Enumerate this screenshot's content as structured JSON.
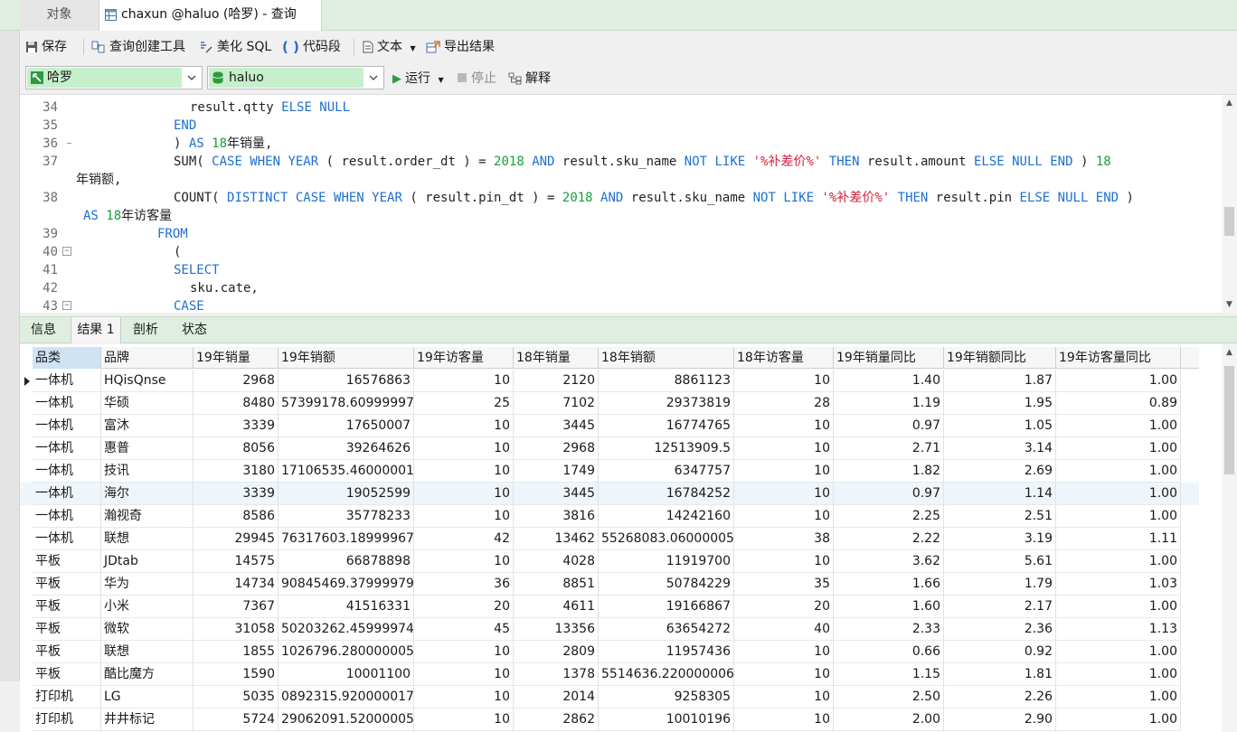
{
  "tabs": {
    "objects": "对象",
    "query": "chaxun @haluo (哈罗) - 查询"
  },
  "toolbar": {
    "save": "保存",
    "query_builder": "查询创建工具",
    "beautify": "美化 SQL",
    "snippet": "代码段",
    "text": "文本",
    "export": "导出结果"
  },
  "connection": {
    "connection_name": "哈罗",
    "database": "haluo",
    "run": "运行",
    "stop": "停止",
    "explain": "解释"
  },
  "editor": {
    "lines": [
      {
        "n": "34",
        "parts": [
          [
            "p",
            "    result.qtty "
          ],
          [
            "k",
            "ELSE NULL"
          ]
        ]
      },
      {
        "n": "35",
        "parts": [
          [
            "k",
            "  END"
          ]
        ]
      },
      {
        "n": "36",
        "parts": [
          [
            "p",
            "  ) "
          ],
          [
            "k",
            "AS "
          ],
          [
            "n",
            "18"
          ],
          [
            "p",
            "年销量,"
          ]
        ]
      },
      {
        "n": "37",
        "parts": [
          [
            "p",
            "  SUM( "
          ],
          [
            "k",
            "CASE WHEN YEAR "
          ],
          [
            "p",
            "( result.order_dt ) = "
          ],
          [
            "n",
            "2018 "
          ],
          [
            "k",
            "AND "
          ],
          [
            "p",
            "result.sku_name "
          ],
          [
            "k",
            "NOT LIKE "
          ],
          [
            "s",
            "'%补差价%' "
          ],
          [
            "k",
            "THEN "
          ],
          [
            "p",
            "result.amount "
          ],
          [
            "k",
            "ELSE NULL END "
          ],
          [
            "p",
            ") "
          ],
          [
            "n",
            "18"
          ]
        ]
      },
      {
        "n": "",
        "parts": [
          [
            "p",
            "年销额,"
          ]
        ]
      },
      {
        "n": "38",
        "parts": [
          [
            "p",
            "  COUNT( "
          ],
          [
            "k",
            "DISTINCT CASE WHEN YEAR "
          ],
          [
            "p",
            "( result.pin_dt ) = "
          ],
          [
            "n",
            "2018 "
          ],
          [
            "k",
            "AND "
          ],
          [
            "p",
            "result.sku_name "
          ],
          [
            "k",
            "NOT LIKE "
          ],
          [
            "s",
            "'%补差价%' "
          ],
          [
            "k",
            "THEN "
          ],
          [
            "p",
            "result.pin "
          ],
          [
            "k",
            "ELSE NULL END "
          ],
          [
            "p",
            ")"
          ]
        ]
      },
      {
        "n": "",
        "parts": [
          [
            "k",
            "AS "
          ],
          [
            "n",
            "18"
          ],
          [
            "p",
            "年访客量"
          ]
        ]
      },
      {
        "n": "39",
        "parts": [
          [
            "k",
            "FROM"
          ]
        ]
      },
      {
        "n": "40",
        "parts": [
          [
            "p",
            "  ("
          ]
        ]
      },
      {
        "n": "41",
        "parts": [
          [
            "k",
            "  SELECT"
          ]
        ]
      },
      {
        "n": "42",
        "parts": [
          [
            "p",
            "    sku.cate,"
          ]
        ]
      },
      {
        "n": "43",
        "parts": [
          [
            "k",
            "  CASE"
          ]
        ]
      }
    ]
  },
  "result_tabs": [
    "信息",
    "结果 1",
    "剖析",
    "状态"
  ],
  "grid": {
    "columns": [
      "品类",
      "品牌",
      "19年销量",
      "19年销额",
      "19年访客量",
      "18年销量",
      "18年销额",
      "18年访客量",
      "19年销量同比",
      "19年销额同比",
      "19年访客量同比"
    ],
    "rows": [
      [
        "一体机",
        "HQisQnse",
        "2968",
        "16576863",
        "10",
        "2120",
        "8861123",
        "10",
        "1.40",
        "1.87",
        "1.00"
      ],
      [
        "一体机",
        "华硕",
        "8480",
        "57399178.60999997",
        "25",
        "7102",
        "29373819",
        "28",
        "1.19",
        "1.95",
        "0.89"
      ],
      [
        "一体机",
        "富沐",
        "3339",
        "17650007",
        "10",
        "3445",
        "16774765",
        "10",
        "0.97",
        "1.05",
        "1.00"
      ],
      [
        "一体机",
        "惠普",
        "8056",
        "39264626",
        "10",
        "2968",
        "12513909.5",
        "10",
        "2.71",
        "3.14",
        "1.00"
      ],
      [
        "一体机",
        "技讯",
        "3180",
        "17106535.46000001",
        "10",
        "1749",
        "6347757",
        "10",
        "1.82",
        "2.69",
        "1.00"
      ],
      [
        "一体机",
        "海尔",
        "3339",
        "19052599",
        "10",
        "3445",
        "16784252",
        "10",
        "0.97",
        "1.14",
        "1.00"
      ],
      [
        "一体机",
        "瀚视奇",
        "8586",
        "35778233",
        "10",
        "3816",
        "14242160",
        "10",
        "2.25",
        "2.51",
        "1.00"
      ],
      [
        "一体机",
        "联想",
        "29945",
        "76317603.18999967",
        "42",
        "13462",
        "55268083.06000005",
        "38",
        "2.22",
        "3.19",
        "1.11"
      ],
      [
        "平板",
        "JDtab",
        "14575",
        "66878898",
        "10",
        "4028",
        "11919700",
        "10",
        "3.62",
        "5.61",
        "1.00"
      ],
      [
        "平板",
        "华为",
        "14734",
        "90845469.37999979",
        "36",
        "8851",
        "50784229",
        "35",
        "1.66",
        "1.79",
        "1.03"
      ],
      [
        "平板",
        "小米",
        "7367",
        "41516331",
        "20",
        "4611",
        "19166867",
        "20",
        "1.60",
        "2.17",
        "1.00"
      ],
      [
        "平板",
        "微软",
        "31058",
        "50203262.45999974",
        "45",
        "13356",
        "63654272",
        "40",
        "2.33",
        "2.36",
        "1.13"
      ],
      [
        "平板",
        "联想",
        "1855",
        "1026796.280000005",
        "10",
        "2809",
        "11957436",
        "10",
        "0.66",
        "0.92",
        "1.00"
      ],
      [
        "平板",
        "酷比魔方",
        "1590",
        "10001100",
        "10",
        "1378",
        "5514636.220000006",
        "10",
        "1.15",
        "1.81",
        "1.00"
      ],
      [
        "打印机",
        "LG",
        "5035",
        "0892315.920000017",
        "10",
        "2014",
        "9258305",
        "10",
        "2.50",
        "2.26",
        "1.00"
      ],
      [
        "打印机",
        "井井标记",
        "5724",
        "29062091.52000005",
        "10",
        "2862",
        "10010196",
        "10",
        "2.00",
        "2.90",
        "1.00"
      ]
    ]
  }
}
